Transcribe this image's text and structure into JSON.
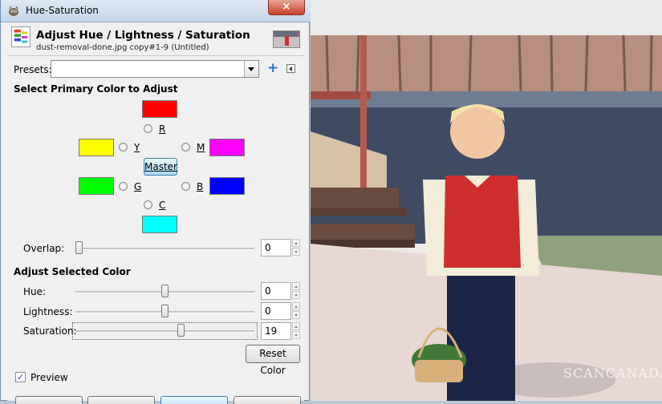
{
  "window": {
    "title": "Hue-Saturation",
    "close_glyph": "×"
  },
  "header": {
    "title": "Adjust Hue / Lightness / Saturation",
    "subtitle": "dust-removal-done.jpg copy#1-9 (Untitled)",
    "icon": "hue-saturation-icon",
    "thumbnail": "image-thumbnail"
  },
  "presets": {
    "label": "Presets:",
    "value": "",
    "add_icon": "plus-icon",
    "menu_icon": "triangle-left-icon"
  },
  "primary": {
    "section_title": "Select Primary Color to Adjust",
    "colors": {
      "R": {
        "label": "R",
        "hex": "#ff0000"
      },
      "Y": {
        "label": "Y",
        "hex": "#ffff00"
      },
      "G": {
        "label": "G",
        "hex": "#00ff00"
      },
      "C": {
        "label": "C",
        "hex": "#00ffff"
      },
      "B": {
        "label": "B",
        "hex": "#0000ff"
      },
      "M": {
        "label": "M",
        "hex": "#ff00ff"
      }
    },
    "master_label": "Master",
    "overlap": {
      "label": "Overlap:",
      "value": "0",
      "level": 0
    }
  },
  "adjust": {
    "section_title": "Adjust Selected Color",
    "hue": {
      "label": "Hue:",
      "value": "0",
      "level": 0.5
    },
    "lightness": {
      "label": "Lightness:",
      "value": "0",
      "level": 0.5
    },
    "saturation": {
      "label": "Saturation:",
      "value": "19",
      "level": 0.595
    },
    "reset_label": "Reset Color"
  },
  "preview": {
    "label": "Preview",
    "checked": true
  },
  "watermark": "SCANCANADA.CA",
  "colors": {
    "accent": "#3c7fb1",
    "title_close": "#c7402b"
  }
}
